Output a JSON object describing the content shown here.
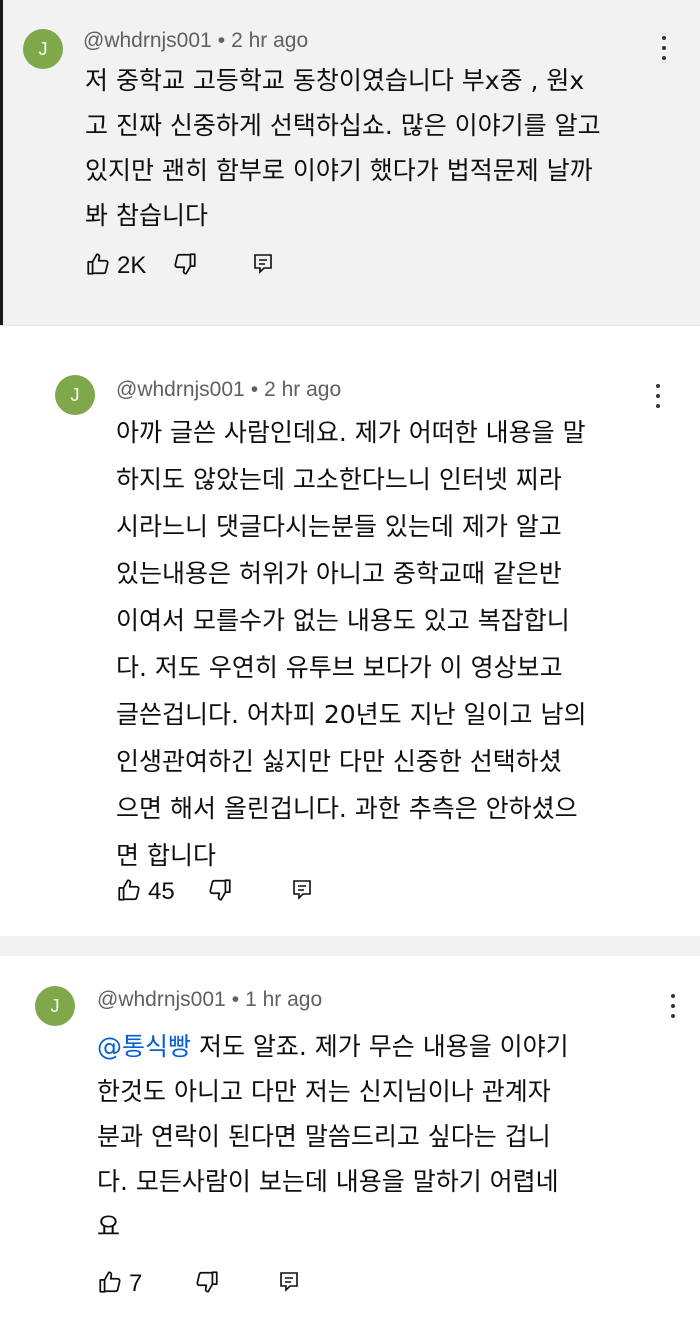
{
  "comments": [
    {
      "avatar_letter": "J",
      "handle": "@whdrnjs001",
      "separator": "•",
      "time": "2 hr ago",
      "lines": [
        "저  중학교 고등학교 동창이였습니다 부x중 , 원x",
        "고 진짜 신중하게 선택하십쇼. 많은 이야기를 알고",
        "있지만 괜히 함부로 이야기 했다가 법적문제 날까",
        "봐 참습니다"
      ],
      "likes": "2K"
    },
    {
      "avatar_letter": "J",
      "handle": "@whdrnjs001",
      "separator": "•",
      "time": "2 hr ago",
      "lines": [
        "아까 글쓴 사람인데요. 제가 어떠한 내용을 말",
        "하지도 않았는데 고소한다느니 인터넷 찌라",
        "시라느니 댓글다시는분들 있는데 제가 알고",
        "있는내용은 허위가 아니고 중학교때 같은반",
        "이여서 모를수가 없는 내용도 있고 복잡합니",
        "다. 저도 우연히 유투브 보다가 이 영상보고",
        "글쓴겁니다. 어차피 20년도 지난 일이고 남의",
        "인생관여하긴 싫지만 다만 신중한 선택하셨",
        "으면 해서 올린겁니다. 과한 추측은 안하셨으",
        "면 합니다"
      ],
      "likes": "45"
    },
    {
      "avatar_letter": "J",
      "handle": "@whdrnjs001",
      "separator": "•",
      "time": "1 hr ago",
      "mention": "@통식빵",
      "first_line_rest": " 저도 알죠. 제가 무슨 내용을 이야기",
      "lines": [
        "한것도 아니고 다만 저는 신지님이나 관계자",
        "분과 연락이 된다면 말씀드리고 싶다는 겁니",
        "다. 모든사람이 보는데 내용을 말하기 어렵네",
        "요"
      ],
      "likes": "7"
    }
  ],
  "icons": {
    "like": "thumbs-up-icon",
    "dislike": "thumbs-down-icon",
    "reply": "reply-icon",
    "menu": "more-vert-icon"
  },
  "colors": {
    "avatar": "#7ea84a",
    "mention": "#065fd4",
    "meta": "#606060",
    "highlight_bg": "#f2f2f2"
  }
}
